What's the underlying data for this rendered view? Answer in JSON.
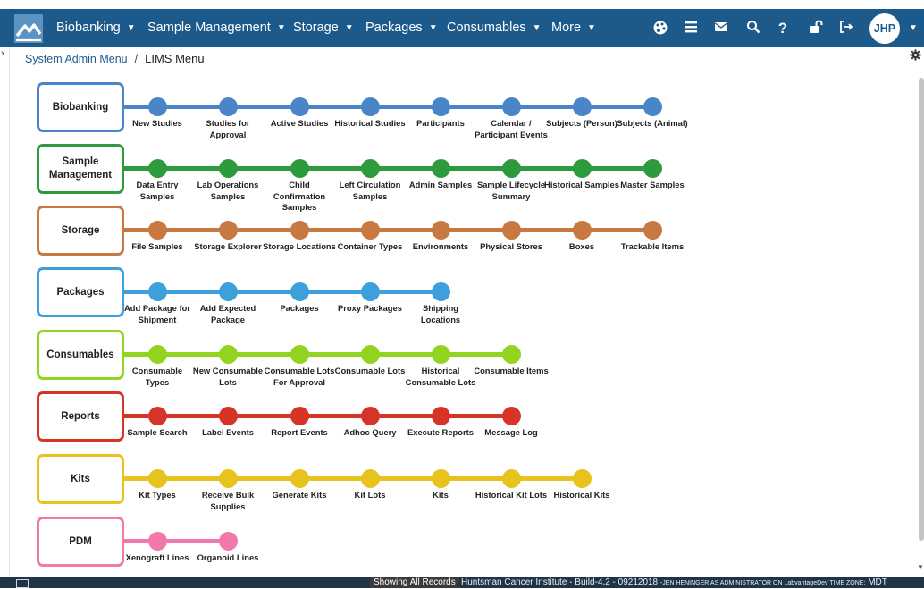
{
  "nav": {
    "items": [
      {
        "label": "Biobanking"
      },
      {
        "label": "Sample Management"
      },
      {
        "label": "Storage"
      },
      {
        "label": "Packages"
      },
      {
        "label": "Consumables"
      },
      {
        "label": "More"
      }
    ],
    "caret": "▼",
    "icons": [
      "palette-icon",
      "hamburger-menu-icon",
      "envelope-icon",
      "search-icon",
      "help-icon",
      "unlock-icon",
      "sign-out-icon"
    ],
    "user_initials": "JHP",
    "avatar_caret": "▼"
  },
  "breadcrumb": {
    "parent": "System Admin Menu",
    "separator": "/",
    "current": "LIMS Menu"
  },
  "menu": [
    {
      "title": "Biobanking",
      "color": "#4a86c7",
      "items": [
        "New Studies",
        "Studies for Approval",
        "Active Studies",
        "Historical Studies",
        "Participants",
        "Calendar / Participant Events",
        "Subjects (Person)",
        "Subjects (Animal)"
      ]
    },
    {
      "title": "Sample Management",
      "color": "#2e9a3e",
      "items": [
        "Data Entry Samples",
        "Lab Operations Samples",
        "Child Confirmation Samples",
        "Left Circulation Samples",
        "Admin Samples",
        "Sample Lifecycle Summary",
        "Historical Samples",
        "Master Samples"
      ]
    },
    {
      "title": "Storage",
      "color": "#c87941",
      "items": [
        "File Samples",
        "Storage Explorer",
        "Storage Locations",
        "Container Types",
        "Environments",
        "Physical Stores",
        "Boxes",
        "Trackable Items"
      ]
    },
    {
      "title": "Packages",
      "color": "#3d9fdb",
      "items": [
        "Add Package for Shipment",
        "Add Expected Package",
        "Packages",
        "Proxy Packages",
        "Shipping Locations"
      ]
    },
    {
      "title": "Consumables",
      "color": "#92d41f",
      "items": [
        "Consumable Types",
        "New Consumable Lots",
        "Consumable Lots For Approval",
        "Consumable Lots",
        "Historical Consumable Lots",
        "Consumable Items"
      ]
    },
    {
      "title": "Reports",
      "color": "#d63426",
      "items": [
        "Sample Search",
        "Label Events",
        "Report Events",
        "Adhoc Query",
        "Execute Reports",
        "Message Log"
      ]
    },
    {
      "title": "Kits",
      "color": "#e8c21d",
      "items": [
        "Kit Types",
        "Receive Bulk Supplies",
        "Generate Kits",
        "Kit Lots",
        "Kits",
        "Historical Kit Lots",
        "Historical Kits"
      ]
    },
    {
      "title": "PDM",
      "color": "#f277ab",
      "items": [
        "Xenograft Lines",
        "Organoid Lines"
      ]
    }
  ],
  "footer": {
    "showing": "Showing All Records",
    "info_main": "Huntsman Cancer Institute - Build-4.2 - 09212018",
    "info_user": "-JEN HENINGER AS ADMINISTRATOR ON LabvantageDev TIME ZONE:",
    "timezone": "MDT"
  },
  "colors": {
    "nav_background": "#1d5a8c",
    "category_border": "#1d5a8c",
    "footer_background": "#1f3547"
  }
}
